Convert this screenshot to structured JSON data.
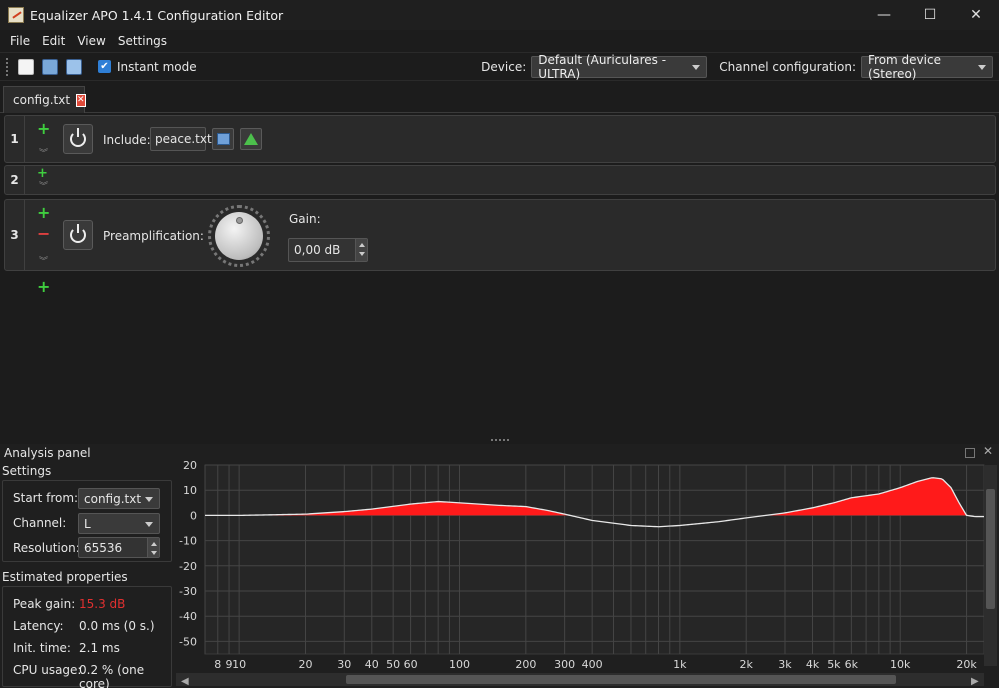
{
  "window": {
    "title": "Equalizer APO 1.4.1 Configuration Editor",
    "minimize_glyph": "—",
    "maximize_glyph": "☐",
    "close_glyph": "✕"
  },
  "menu": [
    "File",
    "Edit",
    "View",
    "Settings"
  ],
  "toolbar": {
    "instant_mode_label": "Instant mode",
    "instant_mode_checked": true,
    "device_label": "Device:",
    "device_value": "Default (Auriculares - ULTRA)",
    "channel_label": "Channel configuration:",
    "channel_value": "From device (Stereo)"
  },
  "tabs": [
    {
      "label": "config.txt",
      "close_glyph": "✕"
    }
  ],
  "filters": [
    {
      "number": "1",
      "include_label": "Include:",
      "include_file": "peace.txt"
    },
    {
      "number": "2"
    },
    {
      "number": "3",
      "preamp_label": "Preamplification:",
      "gain_label": "Gain:",
      "gain_value": "0,00 dB"
    }
  ],
  "analysis": {
    "title": "Analysis panel",
    "settings_title": "Settings",
    "start_from_label": "Start from:",
    "start_from_value": "config.txt",
    "channel_label": "Channel:",
    "channel_value": "L",
    "resolution_label": "Resolution:",
    "resolution_value": "65536",
    "estimated_title": "Estimated properties",
    "peak_gain_label": "Peak gain:",
    "peak_gain_value": "15.3 dB",
    "latency_label": "Latency:",
    "latency_value": "0.0 ms (0 s.)",
    "init_time_label": "Init. time:",
    "init_time_value": "2.1 ms",
    "cpu_label": "CPU usage:",
    "cpu_value": "0.2 % (one core)"
  },
  "colors": {
    "accent": "#2f7fd6",
    "fill_positive": "#ff1a1a",
    "peak_gain_text": "#e03030",
    "add_green": "#3fce3f",
    "remove_red": "#e04040"
  },
  "chart_data": {
    "type": "area",
    "xscale": "log",
    "xlim": [
      7,
      24000
    ],
    "ylim": [
      -55,
      20
    ],
    "ylabel": "",
    "xlabel": "",
    "yticks": [
      20,
      10,
      0,
      -10,
      -20,
      -30,
      -40,
      -50
    ],
    "xtick_labels": [
      {
        "f": 8,
        "label": "8"
      },
      {
        "f": 9,
        "label": "9"
      },
      {
        "f": 10,
        "label": "10"
      },
      {
        "f": 20,
        "label": "20"
      },
      {
        "f": 30,
        "label": "30"
      },
      {
        "f": 40,
        "label": "40"
      },
      {
        "f": 50,
        "label": "50"
      },
      {
        "f": 60,
        "label": "60"
      },
      {
        "f": 100,
        "label": "100"
      },
      {
        "f": 200,
        "label": "200"
      },
      {
        "f": 300,
        "label": "300"
      },
      {
        "f": 400,
        "label": "400"
      },
      {
        "f": 1000,
        "label": "1k"
      },
      {
        "f": 2000,
        "label": "2k"
      },
      {
        "f": 3000,
        "label": "3k"
      },
      {
        "f": 4000,
        "label": "4k"
      },
      {
        "f": 5000,
        "label": "5k"
      },
      {
        "f": 6000,
        "label": "6k"
      },
      {
        "f": 10000,
        "label": "10k"
      },
      {
        "f": 20000,
        "label": "20k"
      }
    ],
    "grid": true,
    "series": [
      {
        "points": [
          [
            7,
            0
          ],
          [
            10,
            0
          ],
          [
            20,
            0.5
          ],
          [
            30,
            1.5
          ],
          [
            40,
            2.5
          ],
          [
            60,
            4.5
          ],
          [
            80,
            5.5
          ],
          [
            100,
            5
          ],
          [
            150,
            4
          ],
          [
            200,
            3.5
          ],
          [
            250,
            2
          ],
          [
            300,
            0.5
          ],
          [
            400,
            -2
          ],
          [
            600,
            -4
          ],
          [
            800,
            -4.5
          ],
          [
            1000,
            -4
          ],
          [
            1500,
            -2.5
          ],
          [
            2000,
            -1
          ],
          [
            3000,
            1
          ],
          [
            4000,
            3
          ],
          [
            5000,
            5
          ],
          [
            6000,
            7
          ],
          [
            8000,
            8.5
          ],
          [
            10000,
            11
          ],
          [
            12000,
            13.5
          ],
          [
            14000,
            15
          ],
          [
            15500,
            14.5
          ],
          [
            17000,
            11
          ],
          [
            18500,
            5
          ],
          [
            20000,
            0
          ],
          [
            22000,
            -0.5
          ],
          [
            24000,
            -0.5
          ]
        ]
      }
    ]
  }
}
